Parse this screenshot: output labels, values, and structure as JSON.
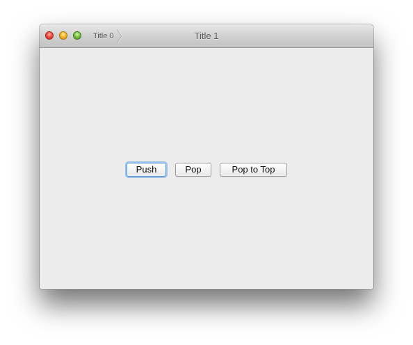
{
  "window": {
    "title": "Title 1"
  },
  "breadcrumb": {
    "items": [
      {
        "label": "Title 0"
      }
    ]
  },
  "buttons": {
    "push_label": "Push",
    "pop_label": "Pop",
    "pop_to_top_label": "Pop to Top"
  },
  "colors": {
    "close": "#ec4f45",
    "minimize": "#f5b92d",
    "zoom": "#7cc24a",
    "focus_ring": "#5e9ad6",
    "content_background": "#ececec"
  }
}
